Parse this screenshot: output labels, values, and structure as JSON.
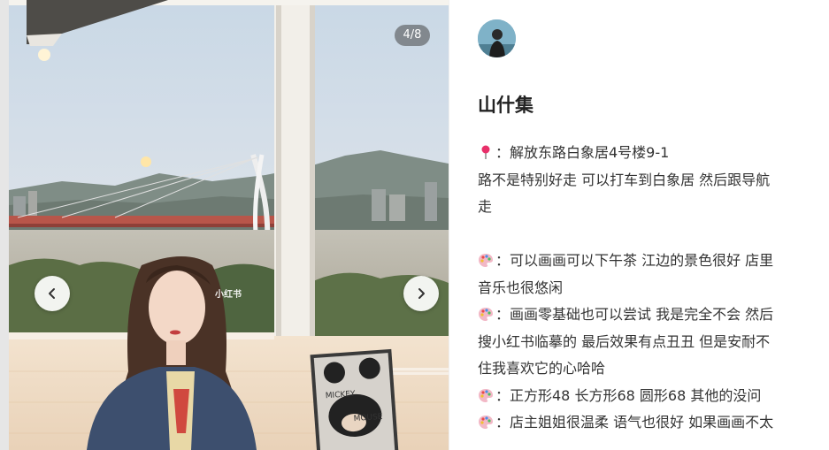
{
  "gallery": {
    "counter": "4/8",
    "watermark": "小红书",
    "prev_label": "previous-image",
    "next_label": "next-image",
    "artwork_text_1": "MICKEY",
    "artwork_text_2": "MOUSE"
  },
  "note": {
    "title": "山什集",
    "lines": [
      {
        "icon": "pin-icon",
        "text": "：解放东路白象居4号楼9-1"
      },
      {
        "icon": "",
        "text": "路不是特别好走 可以打车到白象居 然后跟导航"
      },
      {
        "icon": "",
        "text": "走"
      },
      {
        "icon": "",
        "text": ""
      },
      {
        "icon": "palette-icon",
        "text": "：可以画画可以下午茶 江边的景色很好 店里"
      },
      {
        "icon": "",
        "text": "音乐也很悠闲"
      },
      {
        "icon": "palette-icon",
        "text": "：画画零基础也可以尝试 我是完全不会 然后"
      },
      {
        "icon": "",
        "text": "搜小红书临摹的 最后效果有点丑丑 但是安耐不"
      },
      {
        "icon": "",
        "text": "住我喜欢它的心哈哈"
      },
      {
        "icon": "palette-icon",
        "text": "：正方形48 长方形68 圆形68 其他的没问"
      },
      {
        "icon": "palette-icon",
        "text": "：店主姐姐很温柔 语气也很好 如果画画不太"
      }
    ]
  },
  "colors": {
    "pin": "#e8306a",
    "palette": "#f2b8c6"
  }
}
